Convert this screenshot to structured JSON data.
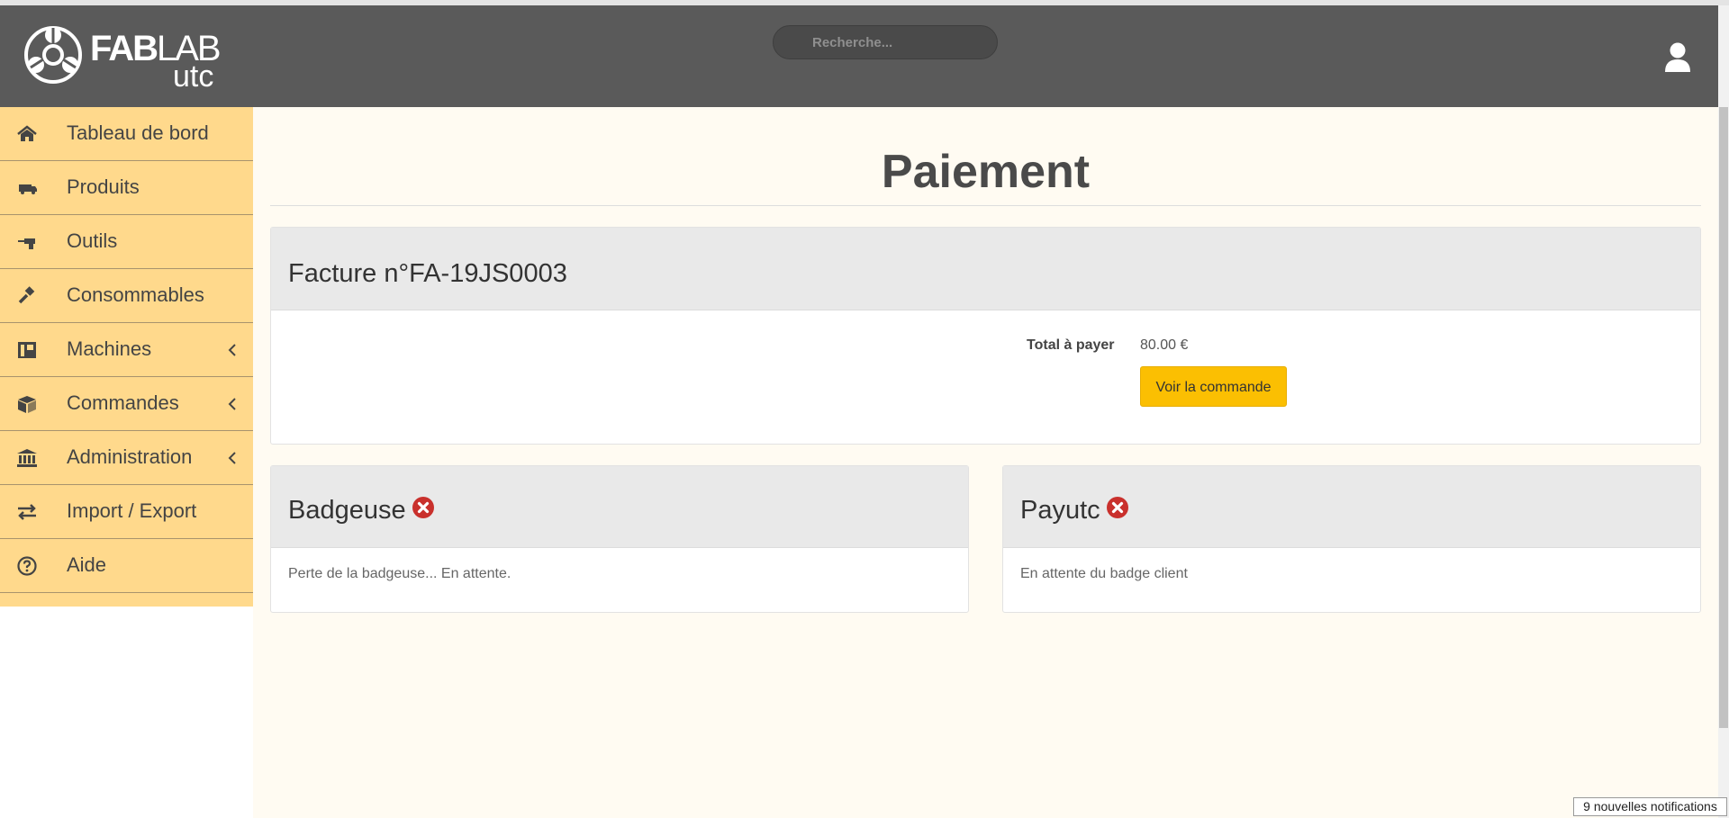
{
  "brand": {
    "name_bold": "FAB",
    "name_light": "LAB",
    "subtitle": "utc"
  },
  "header": {
    "search_placeholder": "Recherche...",
    "user_icon": "user-icon"
  },
  "sidebar": {
    "items": [
      {
        "label": "Tableau de bord",
        "icon": "home-icon",
        "has_submenu": false
      },
      {
        "label": "Produits",
        "icon": "truck-icon",
        "has_submenu": false
      },
      {
        "label": "Outils",
        "icon": "drill-icon",
        "has_submenu": false
      },
      {
        "label": "Consommables",
        "icon": "gavel-icon",
        "has_submenu": false
      },
      {
        "label": "Machines",
        "icon": "machine-icon",
        "has_submenu": true
      },
      {
        "label": "Commandes",
        "icon": "box-icon",
        "has_submenu": true
      },
      {
        "label": "Administration",
        "icon": "bank-icon",
        "has_submenu": true
      },
      {
        "label": "Import / Export",
        "icon": "exchange-icon",
        "has_submenu": false
      },
      {
        "label": "Aide",
        "icon": "question-circle-icon",
        "has_submenu": false
      }
    ]
  },
  "main": {
    "title": "Paiement",
    "invoice": {
      "title": "Facture n°FA-19JS0003",
      "total_label": "Total à payer",
      "total_value": "80.00 €",
      "button_label": "Voir la commande"
    },
    "badgeuse": {
      "title": "Badgeuse",
      "status_icon": "error-circle-icon",
      "message": "Perte de la badgeuse... En attente."
    },
    "payutc": {
      "title": "Payutc",
      "status_icon": "error-circle-icon",
      "message": "En attente du badge client"
    }
  },
  "notification": {
    "text": "9 nouvelles notifications"
  },
  "colors": {
    "topbar": "#5a5a5a",
    "sidebar": "#ffd98c",
    "content_bg": "#fffbf2",
    "accent_button": "#fbbf02",
    "error": "#c9302c"
  }
}
